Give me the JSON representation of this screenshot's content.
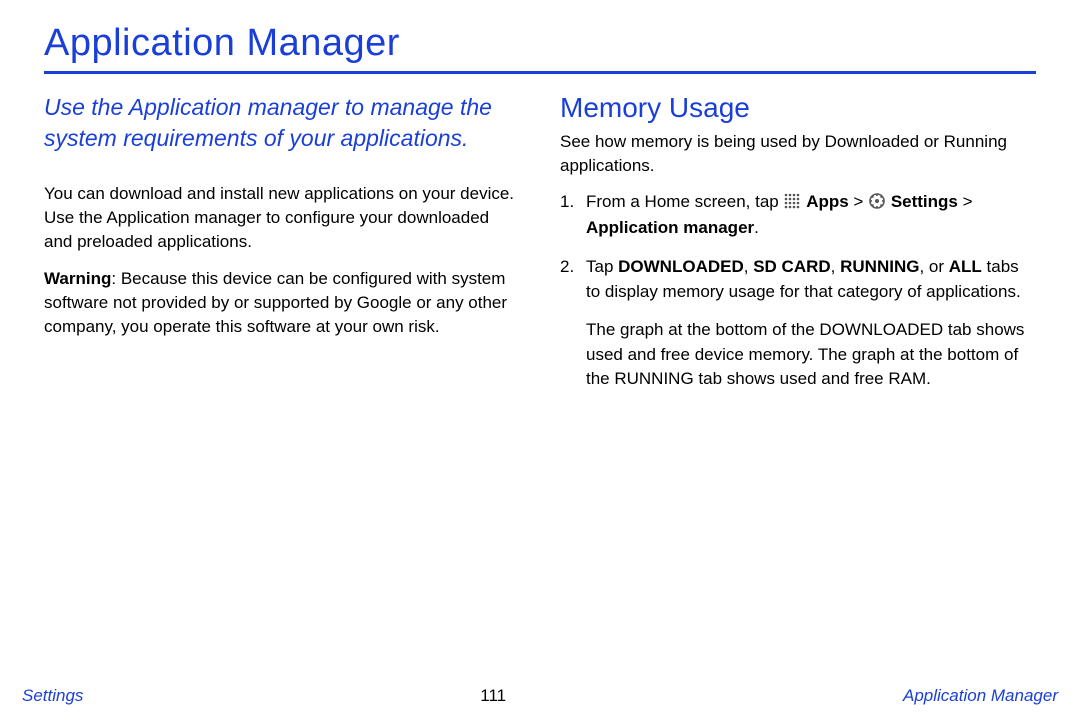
{
  "title": "Application Manager",
  "lead": "Use the Application manager to manage the system requirements of your applications.",
  "left": {
    "p1": "You can download and install new applications on your device. Use the Application manager to configure your downloaded and preloaded applications.",
    "warning_label": "Warning",
    "warning_text": ": Because this device can be configured with system software not provided by or supported by Google or any other company, you operate this software at your own risk."
  },
  "right": {
    "h2": "Memory Usage",
    "intro": "See how memory is being used by Downloaded or Running applications.",
    "steps": {
      "s1_num": "1.",
      "s1_a": "From a Home screen, tap ",
      "s1_apps": "Apps",
      "s1_gt1": " > ",
      "s1_settings": "Settings",
      "s1_gt2": " > ",
      "s1_appmgr": "Application manager",
      "s1_end": ".",
      "s2_num": "2.",
      "s2_a": "Tap ",
      "s2_dl": "DOWNLOADED",
      "s2_c1": ", ",
      "s2_sd": "SD CARD",
      "s2_c2": ", ",
      "s2_run": "RUNNING",
      "s2_c3": ", or ",
      "s2_all": "ALL",
      "s2_b": " tabs to display memory usage for that category of applications.",
      "s2_cont": "The graph at the bottom of the DOWNLOADED tab shows used and free device memory. The graph at the bottom of the RUNNING tab shows used and free RAM."
    }
  },
  "footer": {
    "left": "Settings",
    "center": "111",
    "right": "Application Manager"
  }
}
